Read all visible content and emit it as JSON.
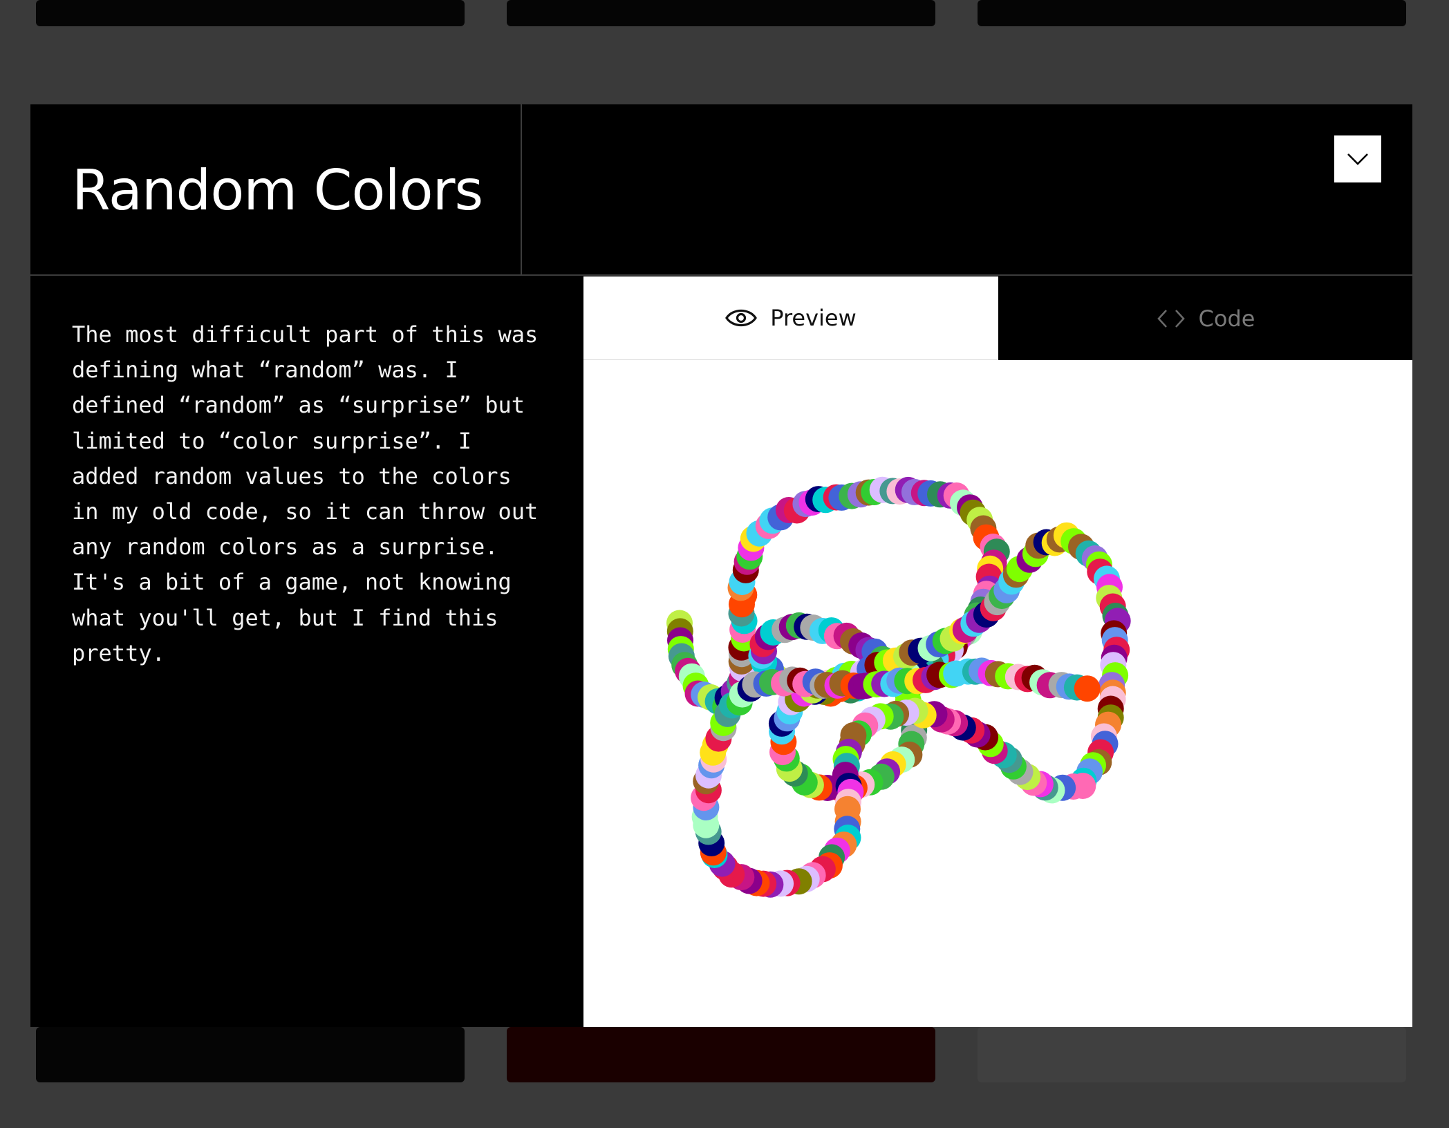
{
  "modal": {
    "title": "Random Colors",
    "description": "The most difficult part of this was\ndefining what “random” was. I\ndefined “random” as “surprise” but\nlimited to “color surprise”. I\nadded random values to the colors\nin my old code, so it can throw out\nany random colors as a surprise.\nIt's a bit of a game, not knowing\nwhat you'll get, but I find this\npretty.",
    "collapse_icon": "chevron-down-icon"
  },
  "tabs": [
    {
      "label": "Preview",
      "icon": "eye-icon",
      "active": true
    },
    {
      "label": "Code",
      "icon": "code-icon",
      "active": false
    }
  ],
  "preview": {
    "art": "random colored circles tracing a looping path"
  },
  "colors": {
    "modal_bg": "#000000",
    "backdrop": "#3a3a3a",
    "inactive_tab_text": "#7a7a7a"
  }
}
